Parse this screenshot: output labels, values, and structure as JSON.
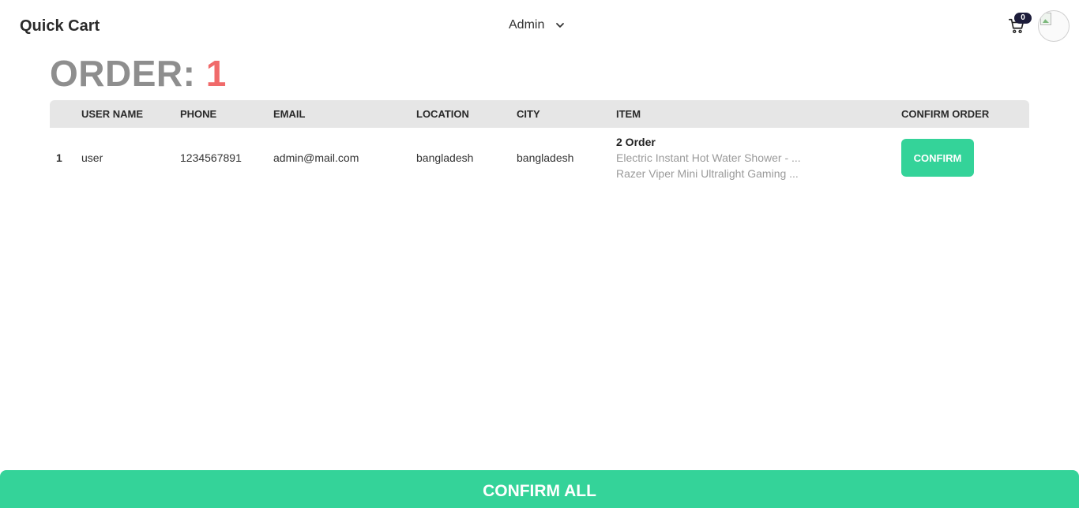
{
  "navbar": {
    "brand": "Quick Cart",
    "admin_label": "Admin",
    "cart_count": "0"
  },
  "page": {
    "title_prefix": "ORDER:",
    "title_count": "1"
  },
  "table": {
    "headers": [
      "",
      "USER NAME",
      "PHONE",
      "EMAIL",
      "LOCATION",
      "CITY",
      "ITEM",
      "CONFIRM ORDER"
    ],
    "rows": [
      {
        "index": "1",
        "user_name": "user",
        "phone": "1234567891",
        "email": "admin@mail.com",
        "location": "bangladesh",
        "city": "bangladesh",
        "item_count": "2 Order",
        "items": [
          "Electric Instant Hot Water Shower - ...",
          "Razer Viper Mini Ultralight Gaming ..."
        ],
        "confirm_label": "CONFIRM"
      }
    ]
  },
  "footer": {
    "confirm_all_label": "CONFIRM ALL"
  },
  "colors": {
    "accent_green": "#34d399",
    "count_red": "#f06a6a",
    "title_gray": "#8e8e8e",
    "header_bg": "#e6e6e6"
  },
  "icons": [
    "cart-icon",
    "chevron-down-icon",
    "avatar-image"
  ]
}
